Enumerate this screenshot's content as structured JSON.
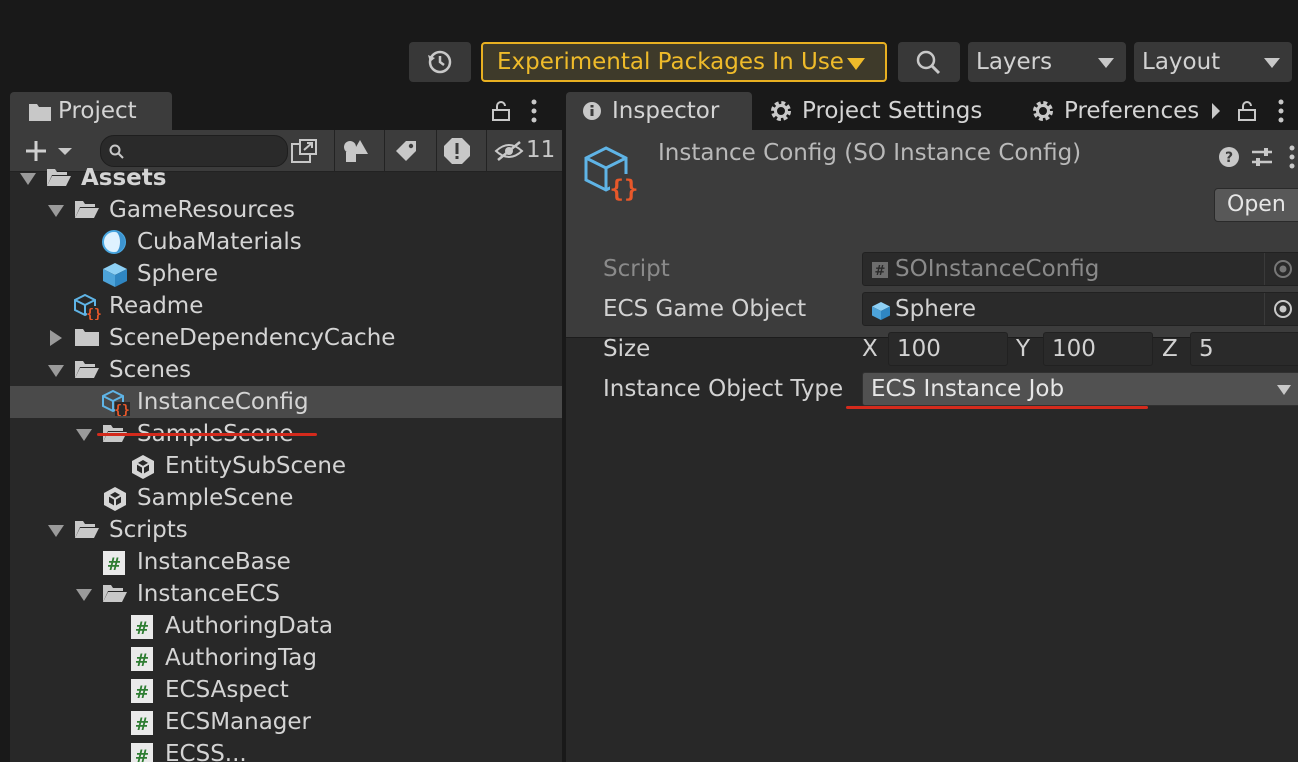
{
  "toolbar": {
    "experimental_label": "Experimental Packages In Use",
    "layers_label": "Layers",
    "layout_label": "Layout"
  },
  "project": {
    "tab_label": "Project",
    "hidden_count": "11",
    "tree": [
      {
        "label": "Assets",
        "depth": 0,
        "fold": "open",
        "icon": "folder-open-icon",
        "bold": true
      },
      {
        "label": "GameResources",
        "depth": 1,
        "fold": "open",
        "icon": "folder-open-icon"
      },
      {
        "label": "CubaMaterials",
        "depth": 2,
        "fold": "none",
        "icon": "material-icon"
      },
      {
        "label": "Sphere",
        "depth": 2,
        "fold": "none",
        "icon": "prefab-icon"
      },
      {
        "label": "Readme",
        "depth": 1,
        "fold": "none",
        "icon": "scriptable-object-icon"
      },
      {
        "label": "SceneDependencyCache",
        "depth": 1,
        "fold": "closed",
        "icon": "folder-icon"
      },
      {
        "label": "Scenes",
        "depth": 1,
        "fold": "open",
        "icon": "folder-open-icon"
      },
      {
        "label": "InstanceConfig",
        "depth": 2,
        "fold": "none",
        "icon": "scriptable-object-icon",
        "selected": true
      },
      {
        "label": "SampleScene",
        "depth": 2,
        "fold": "open",
        "icon": "folder-open-icon"
      },
      {
        "label": "EntitySubScene",
        "depth": 3,
        "fold": "none",
        "icon": "unity-scene-icon"
      },
      {
        "label": "SampleScene",
        "depth": 2,
        "fold": "none",
        "icon": "unity-scene-icon"
      },
      {
        "label": "Scripts",
        "depth": 1,
        "fold": "open",
        "icon": "folder-open-icon"
      },
      {
        "label": "InstanceBase",
        "depth": 2,
        "fold": "none",
        "icon": "csharp-script-icon"
      },
      {
        "label": "InstanceECS",
        "depth": 2,
        "fold": "open",
        "icon": "folder-open-icon"
      },
      {
        "label": "AuthoringData",
        "depth": 3,
        "fold": "none",
        "icon": "csharp-script-icon"
      },
      {
        "label": "AuthoringTag",
        "depth": 3,
        "fold": "none",
        "icon": "csharp-script-icon"
      },
      {
        "label": "ECSAspect",
        "depth": 3,
        "fold": "none",
        "icon": "csharp-script-icon"
      },
      {
        "label": "ECSManager",
        "depth": 3,
        "fold": "none",
        "icon": "csharp-script-icon"
      },
      {
        "label": "ECSS...",
        "depth": 3,
        "fold": "none",
        "icon": "csharp-script-icon"
      }
    ]
  },
  "inspector": {
    "tabs": [
      "Inspector",
      "Project Settings",
      "Preferences"
    ],
    "title": "Instance Config (SO Instance Config)",
    "open_label": "Open",
    "fields": {
      "script_label": "Script",
      "script_value": "SOInstanceConfig",
      "ecs_label": "ECS Game Object",
      "ecs_value": "Sphere",
      "size_label": "Size",
      "size_x_label": "X",
      "size_x": "100",
      "size_y_label": "Y",
      "size_y": "100",
      "size_z_label": "Z",
      "size_z": "5",
      "type_label": "Instance Object Type",
      "type_value": "ECS Instance Job"
    }
  },
  "colors": {
    "accent_warning": "#efbb2a",
    "annotation_red": "#d42a1c",
    "selection": "#4a4a4a"
  }
}
